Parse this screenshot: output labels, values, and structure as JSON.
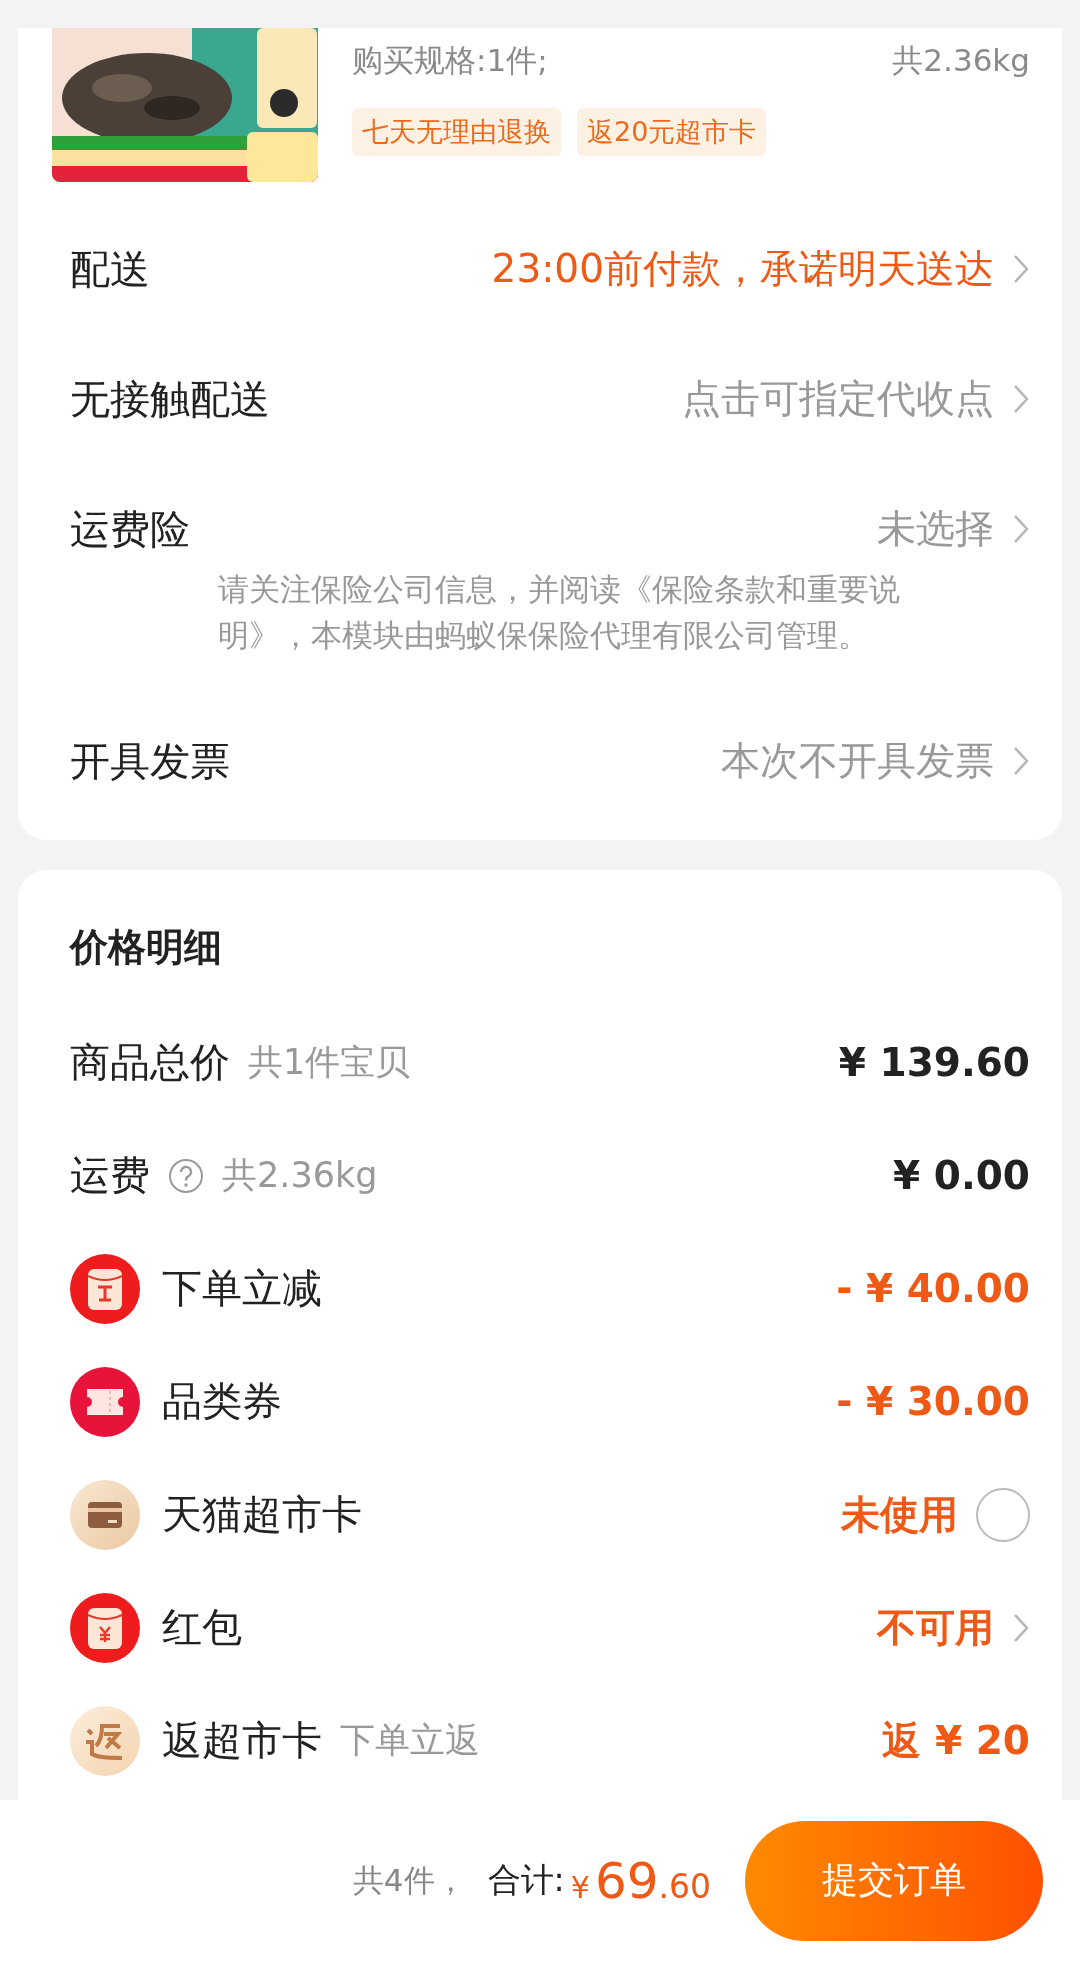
{
  "product": {
    "spec": "购买规格:1件;",
    "weight": "共2.36kg",
    "tags": [
      "七天无理由退换",
      "返20元超市卡"
    ]
  },
  "options": [
    {
      "label": "配送",
      "value": "23:00前付款，承诺明天送达",
      "highlight": true
    },
    {
      "label": "无接触配送",
      "value": "点击可指定代收点",
      "highlight": false
    },
    {
      "label": "运费险",
      "value": "未选择",
      "highlight": false,
      "note": "请关注保险公司信息，并阅读《保险条款和重要说明》，本模块由蚂蚁保保险代理有限公司管理。"
    },
    {
      "label": "开具发票",
      "value": "本次不开具发票",
      "highlight": false
    }
  ],
  "price_detail": {
    "title": "价格明细",
    "rows": [
      {
        "kind": "plain",
        "label": "商品总价",
        "sub": "共1件宝贝",
        "value": "¥ 139.60",
        "accent": false
      },
      {
        "kind": "plain",
        "label": "运费",
        "help": true,
        "sub": "共2.36kg",
        "value": "¥ 0.00",
        "accent": false
      },
      {
        "kind": "icon",
        "label": "下单立减",
        "value": "- ¥ 40.00",
        "accent": true
      },
      {
        "kind": "icon",
        "label": "品类券",
        "value": "- ¥ 30.00",
        "accent": true
      },
      {
        "kind": "radio",
        "label": "天猫超市卡",
        "value": "未使用",
        "accent": true,
        "checked": false
      },
      {
        "kind": "link",
        "label": "红包",
        "value": "不可用",
        "accent": true
      },
      {
        "kind": "icon",
        "label": "返超市卡",
        "sub": "下单立返",
        "value": "返 ¥ 20",
        "accent": true
      }
    ]
  },
  "bottom": {
    "count": "共4件，",
    "total_label": "合计:",
    "currency": "¥",
    "total_int": "69",
    "total_dec": ".60",
    "submit": "提交订单"
  }
}
